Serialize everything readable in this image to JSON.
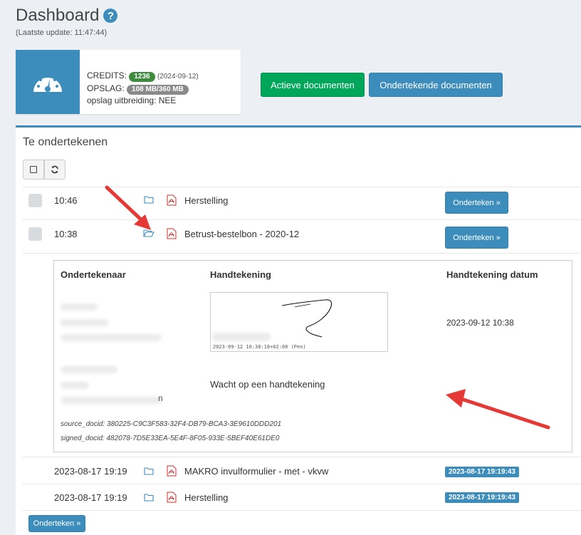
{
  "header": {
    "title": "Dashboard",
    "help_icon": "question-circle-icon",
    "updated": "(Laatste update: 11:47:44)"
  },
  "stats": {
    "icon": "gauge-icon",
    "credits_label": "CREDITS:",
    "credits_value": "1236",
    "credits_date": "(2024-09-12)",
    "storage_label": "OPSLAG:",
    "storage_value": "108 MB/360 MB",
    "extension": "opslag uitbreiding: NEE"
  },
  "buttons": {
    "active_documents": "Actieve documenten",
    "signing_documents": "Ondertekende documenten"
  },
  "panel": {
    "title": "Te ondertekenen",
    "toolbar": {
      "select_all_icon": "checkbox-icon",
      "refresh_icon": "refresh-icon"
    },
    "rows": [
      {
        "time": "10:46",
        "name": "Herstelling",
        "action": "Onderteken »",
        "folder_state": "closed"
      },
      {
        "time": "10:38",
        "name": "Betrust-bestelbon - 2020-12",
        "action": "Onderteken »",
        "folder_state": "open"
      },
      {
        "time": "2023-08-17 19:19",
        "name": "MAKRO invulformulier - met - vkvw",
        "badge": "2023-08-17 19:19:43"
      },
      {
        "time": "2023-08-17 19:19",
        "name": "Herstelling",
        "badge": "2023-08-17 19:19:43"
      }
    ],
    "details": {
      "col_signer": "Ondertekenaar",
      "col_signature": "Handtekening",
      "col_date": "Handtekening datum",
      "signers": [
        {
          "signature_caption": "2023-09-12 10:38:18+02:00 (Pen)",
          "signature_date": "2023-09-12 10:38"
        },
        {
          "status": "Wacht op een handtekening",
          "email_fragment": "n"
        }
      ],
      "source_docid": "source_docid: 380225-C9C3F583-32F4-DB79-BCA3-3E9610DDD201",
      "signed_docid": "signed_docid: 482078-7D5E33EA-5E4F-8F05-933E-5BEF40E61DE0"
    },
    "bottom_action": "Onderteken »"
  },
  "colors": {
    "primary": "#3c8dbc",
    "success": "#00a65a",
    "annotation_arrow": "#e53935"
  }
}
